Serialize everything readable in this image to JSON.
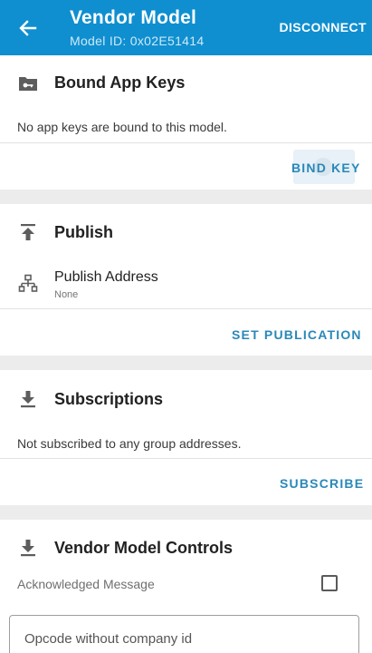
{
  "appbar": {
    "title": "Vendor Model",
    "subtitle": "Model ID: 0x02E51414",
    "action": "DISCONNECT"
  },
  "app_keys": {
    "title": "Bound App Keys",
    "message": "No app keys are bound to this model.",
    "action": "BIND KEY",
    "icon": "key-folder-icon"
  },
  "publish": {
    "title": "Publish",
    "address_label": "Publish Address",
    "address_value": "None",
    "action": "SET PUBLICATION",
    "icon": "publish-icon",
    "address_icon": "network-icon"
  },
  "subscriptions": {
    "title": "Subscriptions",
    "message": "Not subscribed to any group addresses.",
    "action": "SUBSCRIBE",
    "icon": "download-icon"
  },
  "controls": {
    "title": "Vendor Model Controls",
    "ack_label": "Acknowledged Message",
    "ack_checked": false,
    "opcode_placeholder": "Opcode without company id",
    "icon": "download-icon"
  },
  "colors": {
    "appbar": "#0f8fd0",
    "accent": "#2a88b8",
    "background": "#ececec"
  }
}
